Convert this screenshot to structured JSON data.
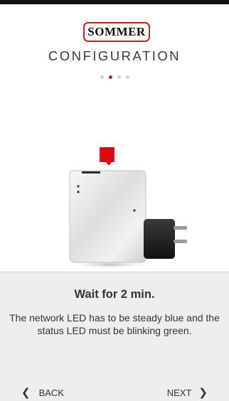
{
  "logo": {
    "text": "SOMMER"
  },
  "header": {
    "title": "CONFIGURATION"
  },
  "pager": {
    "count": 4,
    "active_index": 1
  },
  "colors": {
    "brand_red": "#c21f1f",
    "accent_red": "#e30613",
    "panel_bg": "#eeeeee"
  },
  "instruction": {
    "title": "Wait for 2 min.",
    "text": "The network LED has to be steady blue and the status LED must be blinking green."
  },
  "nav": {
    "back_label": "BACK",
    "back_icon": "chevron-left-icon",
    "next_label": "NEXT",
    "next_icon": "chevron-right-icon"
  }
}
